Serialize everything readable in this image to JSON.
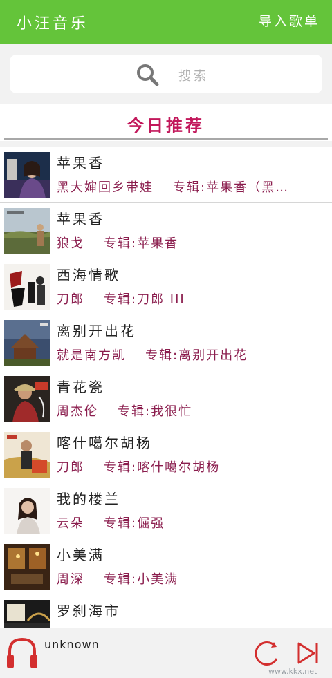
{
  "header": {
    "title": "小汪音乐",
    "import_label": "导入歌单",
    "accent_color": "#64c43a"
  },
  "search": {
    "placeholder": "搜索",
    "icon": "search-icon"
  },
  "recommend": {
    "title": "今日推荐",
    "title_color": "#c2185b"
  },
  "songs": [
    {
      "title": "苹果香",
      "artist": "黑大婶回乡带娃",
      "album": "专辑:苹果香（黑…"
    },
    {
      "title": "苹果香",
      "artist": "狼戈",
      "album": "专辑:苹果香"
    },
    {
      "title": "西海情歌",
      "artist": "刀郎",
      "album": "专辑:刀郎 III"
    },
    {
      "title": "离别开出花",
      "artist": "就是南方凯",
      "album": "专辑:离别开出花"
    },
    {
      "title": "青花瓷",
      "artist": "周杰伦",
      "album": "专辑:我很忙"
    },
    {
      "title": "喀什噶尔胡杨",
      "artist": "刀郎",
      "album": "专辑:喀什噶尔胡杨"
    },
    {
      "title": "我的楼兰",
      "artist": "云朵",
      "album": "专辑:倔强"
    },
    {
      "title": "小美满",
      "artist": "周深",
      "album": "专辑:小美满"
    },
    {
      "title": "罗刹海市",
      "artist": "",
      "album": ""
    }
  ],
  "player": {
    "now_playing": "unknown",
    "icons": [
      "headphones-icon",
      "loop-icon",
      "play-icon"
    ],
    "watermark": "www.kkx.net"
  }
}
